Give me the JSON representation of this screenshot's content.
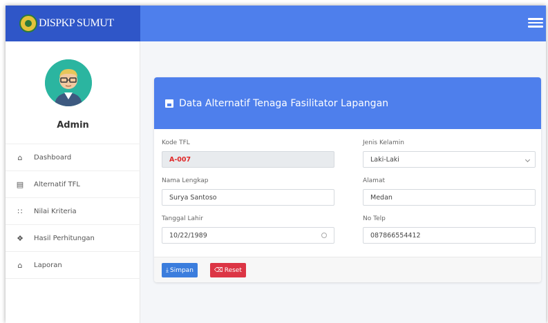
{
  "brand": {
    "name": "DISPKP SUMUT"
  },
  "user": {
    "name": "Admin"
  },
  "sidebar": {
    "items": [
      {
        "label": "Dashboard",
        "icon": "home-icon",
        "glyph": "⌂"
      },
      {
        "label": "Alternatif TFL",
        "icon": "archive-icon",
        "glyph": "▤"
      },
      {
        "label": "Nilai Kriteria",
        "icon": "users-icon",
        "glyph": "∷"
      },
      {
        "label": "Hasil Perhitungan",
        "icon": "calculator-icon",
        "glyph": "❖"
      },
      {
        "label": "Laporan",
        "icon": "basket-icon",
        "glyph": "⌂"
      }
    ]
  },
  "card": {
    "title": "Data Alternatif Tenaga Fasilitator Lapangan",
    "header_color": "#4e7fec"
  },
  "form": {
    "kode_label": "Kode TFL",
    "kode_value": "A-007",
    "jenis_kelamin_label": "Jenis Kelamin",
    "jenis_kelamin_value": "Laki-Laki",
    "nama_label": "Nama Lengkap",
    "nama_value": "Surya Santoso",
    "alamat_label": "Alamat",
    "alamat_value": "Medan",
    "tanggal_label": "Tanggal Lahir",
    "tanggal_value": "10/22/1989",
    "telp_label": "No Telp",
    "telp_value": "087866554412"
  },
  "buttons": {
    "save_label": "Simpan",
    "reset_label": "Reset"
  },
  "colors": {
    "topbar": "#4e7fec",
    "brand_bg": "#2f56c8",
    "save": "#3b7ddd",
    "reset": "#dc3545",
    "code_text": "#e02828"
  }
}
